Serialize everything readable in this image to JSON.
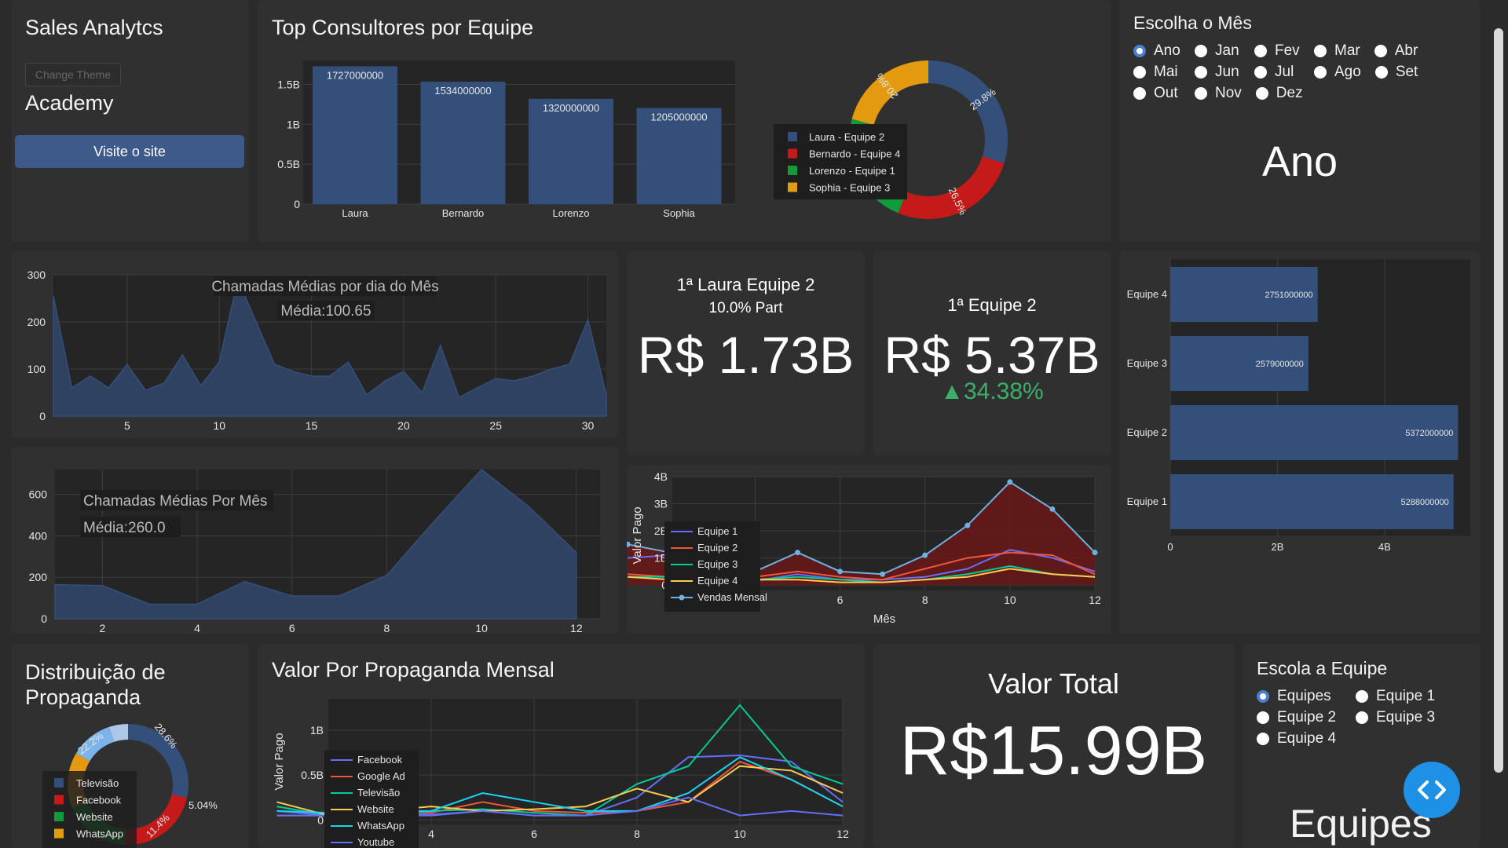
{
  "brand": {
    "title": "Sales Analytcs",
    "change_theme": "Change Theme",
    "academy": "Academy",
    "visit": "Visite o site"
  },
  "top_consultores": {
    "title": "Top Consultores por Equipe",
    "chart_data": {
      "type": "bar",
      "categories": [
        "Laura",
        "Bernardo",
        "Lorenzo",
        "Sophia"
      ],
      "values": [
        1727000000,
        1534000000,
        1320000000,
        1205000000
      ],
      "labels": [
        "1727000000",
        "1534000000",
        "1320000000",
        "1205000000"
      ],
      "y_ticks": [
        "0",
        "0.5B",
        "1B",
        "1.5B"
      ],
      "ylim": [
        0,
        1800000000
      ],
      "color": "#34507a"
    },
    "pie": {
      "type": "pie",
      "legend": [
        "Laura - Equipe 2",
        "Bernardo - Equipe 4",
        "Lorenzo - Equipe 1",
        "Sophia - Equipe 3"
      ],
      "values": [
        29.8,
        26.5,
        23.0,
        20.8
      ],
      "labels": [
        "29.8%",
        "26.5%",
        "23%",
        "20.8%"
      ],
      "colors": [
        "#34507a",
        "#c41a1a",
        "#0f9c3a",
        "#e39a0e"
      ]
    }
  },
  "mes": {
    "title": "Escolha o Mês",
    "options": [
      [
        "Ano",
        "Jan",
        "Fev",
        "Mar",
        "Abr"
      ],
      [
        "Mai",
        "Jun",
        "Jul",
        "Ago",
        "Set"
      ],
      [
        "Out",
        "Nov",
        "Dez"
      ]
    ],
    "selected": "Ano",
    "display": "Ano"
  },
  "chamadas_dia": {
    "title": "Chamadas Médias por dia do Mês",
    "media": "Média:100.65",
    "chart_data": {
      "type": "area",
      "x": [
        1,
        2,
        3,
        4,
        5,
        6,
        7,
        8,
        9,
        10,
        11,
        12,
        13,
        14,
        15,
        16,
        17,
        18,
        19,
        20,
        21,
        22,
        23,
        24,
        25,
        26,
        27,
        28,
        29,
        30,
        31
      ],
      "y": [
        255,
        60,
        85,
        60,
        110,
        55,
        70,
        130,
        65,
        115,
        290,
        200,
        110,
        95,
        85,
        85,
        115,
        45,
        75,
        95,
        50,
        150,
        40,
        60,
        80,
        75,
        85,
        100,
        110,
        205,
        45
      ],
      "x_ticks": [
        "5",
        "10",
        "15",
        "20",
        "25",
        "30"
      ],
      "y_ticks": [
        "0",
        "100",
        "200",
        "300"
      ],
      "ylim": [
        0,
        300
      ]
    }
  },
  "chamadas_mes": {
    "title": "Chamadas Médias Por Mês",
    "media": "Média:260.0",
    "chart_data": {
      "type": "area",
      "x": [
        1,
        2,
        3,
        4,
        5,
        6,
        7,
        8,
        9,
        10,
        11,
        12
      ],
      "y": [
        165,
        160,
        70,
        70,
        180,
        110,
        110,
        210,
        470,
        720,
        540,
        320
      ],
      "x_ticks": [
        "2",
        "4",
        "6",
        "8",
        "10",
        "12"
      ],
      "y_ticks": [
        "0",
        "200",
        "400",
        "600"
      ],
      "ylim": [
        0,
        720
      ]
    }
  },
  "kpi_consultor": {
    "heading": "1ª Laura Equipe 2",
    "sub": "10.0% Part",
    "value": "R$ 1.73B"
  },
  "kpi_equipe": {
    "heading": "1ª Equipe 2",
    "value": "R$ 5.37B",
    "delta": "▲34.38%"
  },
  "equipes_bar": {
    "chart_data": {
      "type": "bar",
      "orientation": "horizontal",
      "categories": [
        "Equipe 4",
        "Equipe 3",
        "Equipe 2",
        "Equipe 1"
      ],
      "values": [
        2751000000,
        2579000000,
        5372000000,
        5288000000
      ],
      "labels": [
        "2751000000",
        "2579000000",
        "5372000000",
        "5288000000"
      ],
      "x_ticks": [
        "0",
        "2B",
        "4B"
      ],
      "xlim": [
        0,
        5600000000
      ]
    }
  },
  "vendas": {
    "ylabel": "Valor Pago",
    "xlabel": "Mês",
    "chart_data": {
      "type": "line",
      "x": [
        1,
        2,
        3,
        4,
        5,
        6,
        7,
        8,
        9,
        10,
        11,
        12
      ],
      "x_ticks": [
        "4",
        "6",
        "8",
        "10",
        "12"
      ],
      "y_ticks": [
        "0",
        "1B",
        "2B",
        "3B",
        "4B"
      ],
      "ylim": [
        -0.2,
        4
      ],
      "series": [
        {
          "name": "Equipe 1",
          "color": "#636efa",
          "values": [
            1.0,
            1.1,
            0.3,
            0.15,
            0.4,
            0.2,
            0.2,
            0.3,
            0.6,
            1.3,
            1.0,
            0.5
          ]
        },
        {
          "name": "Equipe 2",
          "color": "#ef553b",
          "values": [
            0.4,
            0.3,
            0.3,
            0.3,
            0.5,
            0.3,
            0.2,
            0.6,
            1.0,
            1.2,
            1.1,
            0.4
          ]
        },
        {
          "name": "Equipe 3",
          "color": "#00cc96",
          "values": [
            0.3,
            0.3,
            0.3,
            0.2,
            0.3,
            0.2,
            0.1,
            0.2,
            0.4,
            0.7,
            0.4,
            0.3
          ]
        },
        {
          "name": "Equipe 4",
          "color": "#fecb52",
          "values": [
            0.3,
            0.2,
            0.2,
            0.2,
            0.2,
            0.1,
            0.1,
            0.2,
            0.3,
            0.6,
            0.4,
            0.3
          ]
        },
        {
          "name": "Vendas Mensal",
          "color": "#6fb0e0",
          "marker": true,
          "values": [
            1.5,
            1.2,
            0.7,
            0.5,
            1.2,
            0.5,
            0.4,
            1.1,
            2.2,
            3.8,
            2.8,
            1.2
          ]
        }
      ]
    }
  },
  "propaganda_dist": {
    "title_l1": "Distribuição de",
    "title_l2": "Propaganda",
    "pie": {
      "legend": [
        "Televisão",
        "Facebook",
        "Website",
        "WhatsApp"
      ],
      "labels": [
        "28.6%",
        "22.2%",
        "11.4%",
        "5.04%"
      ],
      "values": [
        28.6,
        22.2,
        18,
        15,
        11.4,
        5.04
      ],
      "colors": [
        "#34507a",
        "#c41a1a",
        "#0f9c3a",
        "#e39a0e",
        "#7cb3e8",
        "#aec7e8"
      ]
    }
  },
  "propaganda_mensal": {
    "title": "Valor Por Propaganda Mensal",
    "ylabel": "Valor Pago",
    "chart_data": {
      "type": "line",
      "x": [
        1,
        2,
        3,
        4,
        5,
        6,
        7,
        8,
        9,
        10,
        11,
        12
      ],
      "x_ticks": [
        "4",
        "6",
        "8",
        "10",
        "12"
      ],
      "y_ticks": [
        "0",
        "0.5B",
        "1B"
      ],
      "ylim": [
        -0.05,
        1.35
      ],
      "series": [
        {
          "name": "Facebook",
          "color": "#636efa",
          "values": [
            0.1,
            0.05,
            0.08,
            0.06,
            0.1,
            0.05,
            0.05,
            0.25,
            0.7,
            0.72,
            0.65,
            0.2
          ]
        },
        {
          "name": "Google Ad",
          "color": "#ef553b",
          "values": [
            0.05,
            0.05,
            0.1,
            0.08,
            0.2,
            0.1,
            0.08,
            0.1,
            0.2,
            0.65,
            0.45,
            0.15
          ]
        },
        {
          "name": "Televisão",
          "color": "#00cc96",
          "values": [
            0.15,
            0.05,
            0.05,
            0.1,
            0.12,
            0.08,
            0.05,
            0.4,
            0.6,
            1.28,
            0.6,
            0.4
          ]
        },
        {
          "name": "Website",
          "color": "#fecb52",
          "values": [
            0.2,
            0.05,
            0.1,
            0.15,
            0.1,
            0.12,
            0.15,
            0.35,
            0.2,
            0.6,
            0.55,
            0.3
          ]
        },
        {
          "name": "WhatsApp",
          "color": "#19d3f3",
          "values": [
            0.1,
            0.08,
            0.1,
            0.1,
            0.3,
            0.2,
            0.1,
            0.1,
            0.3,
            0.7,
            0.45,
            0.15
          ]
        },
        {
          "name": "Youtube",
          "color": "#636efa",
          "values": [
            0.05,
            0.05,
            0.05,
            0.05,
            0.1,
            0.05,
            0.05,
            0.1,
            0.25,
            0.05,
            0.1,
            0.05
          ]
        }
      ]
    }
  },
  "valor_total": {
    "title": "Valor Total",
    "value": "R$15.99B"
  },
  "escola_equipe": {
    "title": "Escola a Equipe",
    "options": [
      [
        "Equipes",
        "Equipe 1"
      ],
      [
        "Equipe 2",
        "Equipe 3"
      ],
      [
        "Equipe 4"
      ]
    ],
    "selected": "Equipes",
    "display": "Equipes"
  }
}
